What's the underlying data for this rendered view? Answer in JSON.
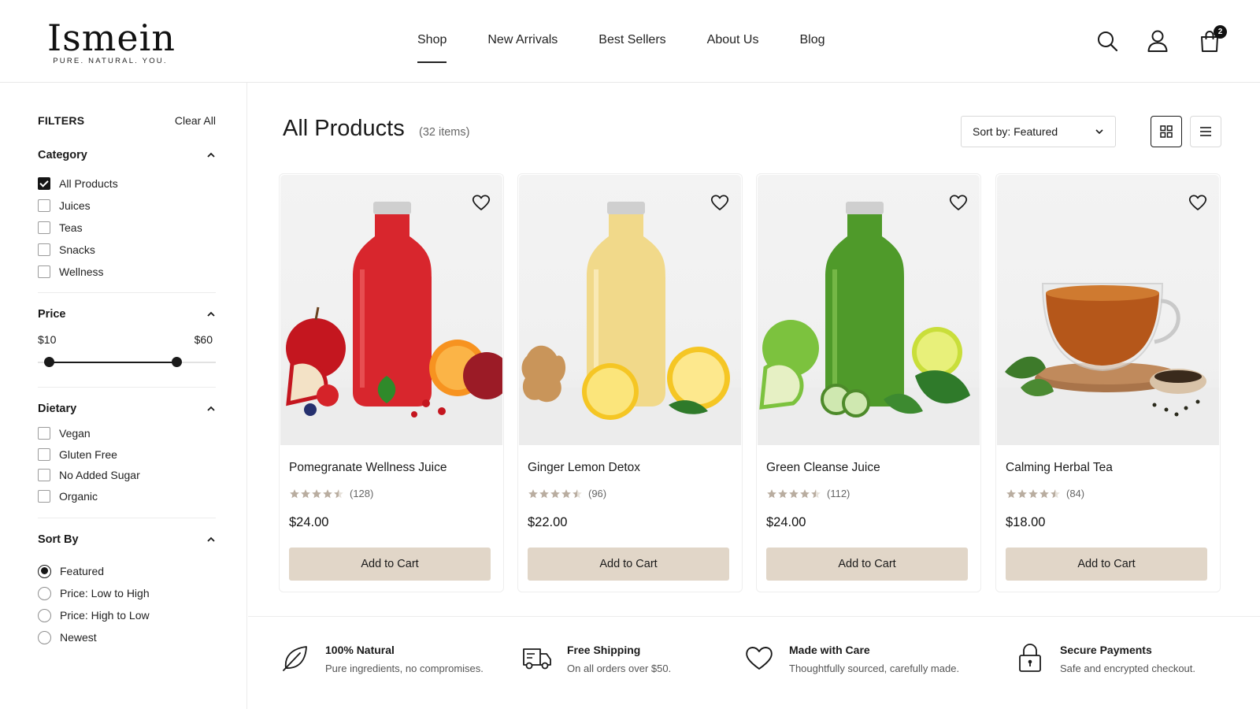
{
  "brand": {
    "name": "Ismein",
    "tagline": "PURE. NATURAL. YOU."
  },
  "nav": [
    {
      "label": "Shop",
      "active": true
    },
    {
      "label": "New Arrivals",
      "active": false
    },
    {
      "label": "Best Sellers",
      "active": false
    },
    {
      "label": "About Us",
      "active": false
    },
    {
      "label": "Blog",
      "active": false
    }
  ],
  "header_icons": [
    "search-icon",
    "account-icon",
    "cart-icon"
  ],
  "cart": {
    "count": "2"
  },
  "filters": {
    "title": "FILTERS",
    "clear_label": "Clear All",
    "category": {
      "title": "Category",
      "options": [
        {
          "label": "All Products",
          "checked": true
        },
        {
          "label": "Juices",
          "checked": false
        },
        {
          "label": "Teas",
          "checked": false
        },
        {
          "label": "Snacks",
          "checked": false
        },
        {
          "label": "Wellness",
          "checked": false
        }
      ]
    },
    "price": {
      "title": "Price",
      "min_label": "$10",
      "max_label": "$60"
    },
    "dietary": {
      "title": "Dietary",
      "options": [
        {
          "label": "Vegan",
          "checked": false
        },
        {
          "label": "Gluten Free",
          "checked": false
        },
        {
          "label": "No Added Sugar",
          "checked": false
        },
        {
          "label": "Organic",
          "checked": false
        }
      ]
    },
    "sort": {
      "title": "Sort By",
      "options": [
        {
          "label": "Featured",
          "checked": true
        },
        {
          "label": "Price: Low to High",
          "checked": false
        },
        {
          "label": "Price: High to Low",
          "checked": false
        },
        {
          "label": "Newest",
          "checked": false
        }
      ]
    }
  },
  "main": {
    "title": "All Products",
    "count": "(32 items)",
    "sort_label": "Sort by: Featured",
    "view_modes": [
      "grid-view-icon",
      "list-view-icon"
    ],
    "active_view": "grid"
  },
  "products": [
    {
      "name": "Pomegranate Wellness Juice",
      "rating": 4.5,
      "reviews": "(128)",
      "price": "$24.00",
      "cta": "Add to Cart",
      "image": "red-juice-bottle",
      "color": "#d8262d"
    },
    {
      "name": "Ginger Lemon Detox",
      "rating": 4.5,
      "reviews": "(96)",
      "price": "$22.00",
      "cta": "Add to Cart",
      "image": "yellow-juice-bottle",
      "color": "#f1d98a"
    },
    {
      "name": "Green Cleanse Juice",
      "rating": 4.5,
      "reviews": "(112)",
      "price": "$24.00",
      "cta": "Add to Cart",
      "image": "green-juice-bottle",
      "color": "#4f9a2a"
    },
    {
      "name": "Calming Herbal Tea",
      "rating": 4.5,
      "reviews": "(84)",
      "price": "$18.00",
      "cta": "Add to Cart",
      "image": "tea-cup",
      "color": "#b5571a"
    }
  ],
  "features": [
    {
      "icon": "leaf-icon",
      "title": "100% Natural",
      "subtitle": "Pure ingredients, no compromises."
    },
    {
      "icon": "truck-icon",
      "title": "Free Shipping",
      "subtitle": "On all orders over $50."
    },
    {
      "icon": "heart-icon",
      "title": "Made with Care",
      "subtitle": "Thoughtfully sourced, carefully made."
    },
    {
      "icon": "lock-icon",
      "title": "Secure Payments",
      "subtitle": "Safe and encrypted checkout."
    }
  ],
  "colors": {
    "button_bg": "#e1d6c8",
    "star": "#b9ada0",
    "border": "#ececec",
    "text": "#1a1a1a"
  }
}
